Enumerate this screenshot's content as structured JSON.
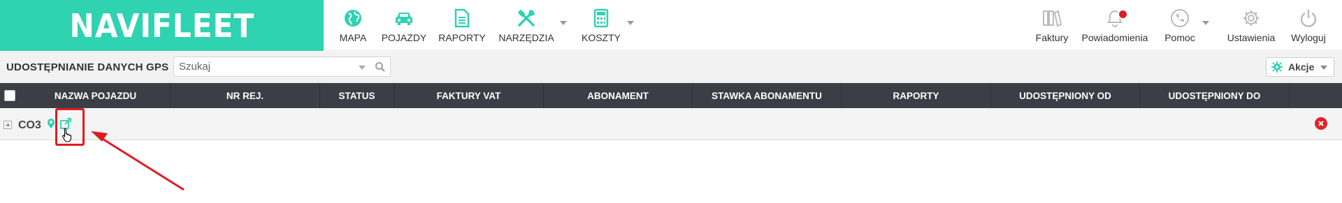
{
  "brand": {
    "logo_text": "NAVIFLEET",
    "accent_color": "#2fd2b1"
  },
  "nav": [
    {
      "id": "mapa",
      "label": "MAPA",
      "icon": "globe-icon"
    },
    {
      "id": "pojazdy",
      "label": "POJAZDY",
      "icon": "car-icon"
    },
    {
      "id": "raporty",
      "label": "RAPORTY",
      "icon": "document-icon"
    },
    {
      "id": "narzedzia",
      "label": "NARZĘDZIA",
      "icon": "tools-icon"
    },
    {
      "id": "koszty",
      "label": "KOSZTY",
      "icon": "calculator-icon"
    }
  ],
  "right_nav": [
    {
      "id": "faktury",
      "label": "Faktury",
      "icon": "binders-icon"
    },
    {
      "id": "powiadomienia",
      "label": "Powiadomienia",
      "icon": "bell-icon"
    },
    {
      "id": "pomoc",
      "label": "Pomoc",
      "icon": "phone-icon"
    },
    {
      "id": "ustawienia",
      "label": "Ustawienia",
      "icon": "gear-icon"
    },
    {
      "id": "wyloguj",
      "label": "Wyloguj",
      "icon": "power-icon"
    }
  ],
  "toolbar": {
    "title": "UDOSTĘPNIANIE DANYCH GPS",
    "search_placeholder": "Szukaj",
    "search_value": "",
    "actions_label": "Akcje"
  },
  "table": {
    "columns": [
      "NAZWA POJAZDU",
      "NR REJ.",
      "STATUS",
      "FAKTURY VAT",
      "ABONAMENT",
      "STAWKA ABONAMENTU",
      "RAPORTY",
      "UDOSTĘPNIONY OD",
      "UDOSTĘPNIONY DO"
    ],
    "rows": [
      {
        "vehicle_name": "CO3"
      }
    ]
  },
  "colors": {
    "header_bg": "#3b3f45",
    "highlight": "#e01b24",
    "delete": "#e0242a",
    "notification_dot": "#e01b24"
  }
}
